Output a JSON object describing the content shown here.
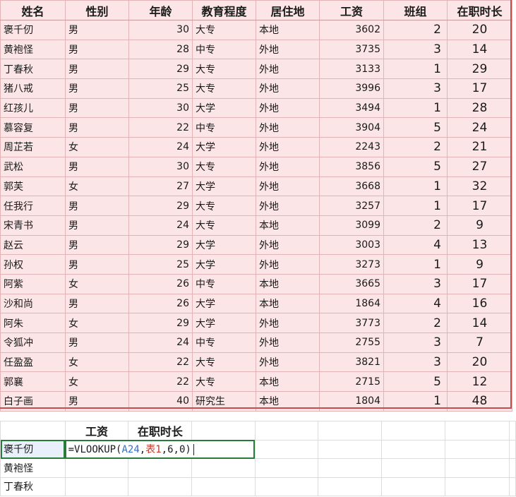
{
  "headers": [
    "姓名",
    "性别",
    "年龄",
    "教育程度",
    "居住地",
    "工资",
    "班组",
    "在职时长"
  ],
  "rows": [
    [
      "褒千仞",
      "男",
      "30",
      "大专",
      "本地",
      "3602",
      "2",
      "20"
    ],
    [
      "黄袍怪",
      "男",
      "28",
      "中专",
      "外地",
      "3735",
      "3",
      "14"
    ],
    [
      "丁春秋",
      "男",
      "29",
      "大专",
      "外地",
      "3133",
      "1",
      "29"
    ],
    [
      "猪八戒",
      "男",
      "25",
      "大专",
      "外地",
      "3996",
      "3",
      "17"
    ],
    [
      "红孩儿",
      "男",
      "30",
      "大学",
      "外地",
      "3494",
      "1",
      "28"
    ],
    [
      "慕容复",
      "男",
      "22",
      "中专",
      "外地",
      "3904",
      "5",
      "24"
    ],
    [
      "周芷若",
      "女",
      "24",
      "大学",
      "外地",
      "2243",
      "2",
      "21"
    ],
    [
      "武松",
      "男",
      "30",
      "大专",
      "外地",
      "3856",
      "5",
      "27"
    ],
    [
      "郭芙",
      "女",
      "27",
      "大学",
      "外地",
      "3668",
      "1",
      "32"
    ],
    [
      "任我行",
      "男",
      "29",
      "大专",
      "外地",
      "3257",
      "1",
      "17"
    ],
    [
      "宋青书",
      "男",
      "24",
      "大专",
      "本地",
      "3099",
      "2",
      "9"
    ],
    [
      "赵云",
      "男",
      "29",
      "大学",
      "外地",
      "3003",
      "4",
      "13"
    ],
    [
      "孙权",
      "男",
      "25",
      "大学",
      "外地",
      "3273",
      "1",
      "9"
    ],
    [
      "阿紫",
      "女",
      "26",
      "中专",
      "本地",
      "3665",
      "3",
      "17"
    ],
    [
      "沙和尚",
      "男",
      "26",
      "大学",
      "本地",
      "1864",
      "4",
      "16"
    ],
    [
      "阿朱",
      "女",
      "29",
      "大学",
      "外地",
      "3773",
      "2",
      "14"
    ],
    [
      "令狐冲",
      "男",
      "24",
      "中专",
      "外地",
      "2755",
      "3",
      "7"
    ],
    [
      "任盈盈",
      "女",
      "22",
      "大专",
      "外地",
      "3821",
      "3",
      "20"
    ],
    [
      "郭襄",
      "女",
      "22",
      "大专",
      "本地",
      "2715",
      "5",
      "12"
    ],
    [
      "白子画",
      "男",
      "40",
      "研究生",
      "本地",
      "1804",
      "1",
      "48"
    ]
  ],
  "lookup": {
    "headers": [
      "工资",
      "在职时长"
    ],
    "names": [
      "褒千仞",
      "黄袍怪",
      "丁春秋"
    ],
    "formula": {
      "prefix": "=VLOOKUP(",
      "ref": "A24",
      "sep1": ",",
      "table": "表1",
      "rest": ",6,0)"
    }
  },
  "colors": {
    "table_fill": "#fbe5e6",
    "table_border": "#c0504d",
    "active_cell": "#2a7a3c",
    "ref_color": "#2f6fd1",
    "table_ref_color": "#c0392b"
  }
}
